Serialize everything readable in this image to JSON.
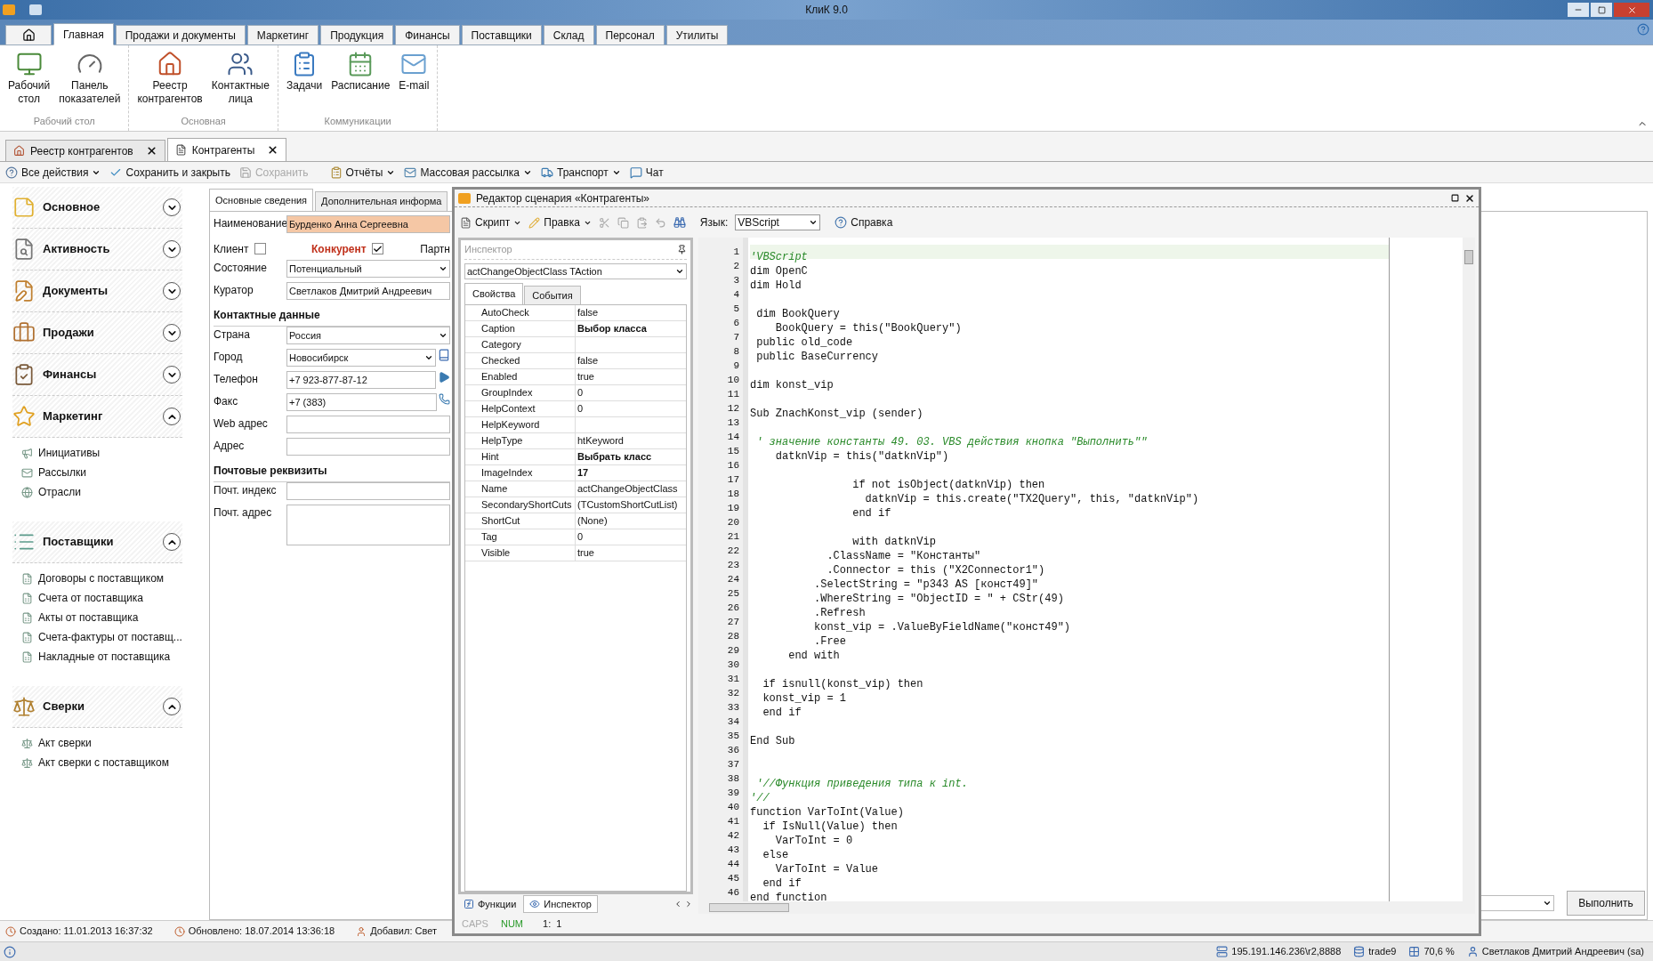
{
  "window": {
    "title": "КлиК 9.0"
  },
  "ribbon": {
    "tabs": [
      {
        "label": "Главная",
        "selected": true
      },
      {
        "label": "Продажи и документы",
        "selected": false
      },
      {
        "label": "Маркетинг",
        "selected": false
      },
      {
        "label": "Продукция",
        "selected": false
      },
      {
        "label": "Финансы",
        "selected": false
      },
      {
        "label": "Поставщики",
        "selected": false
      },
      {
        "label": "Склад",
        "selected": false
      },
      {
        "label": "Персонал",
        "selected": false
      },
      {
        "label": "Утилиты",
        "selected": false
      }
    ],
    "groups": [
      {
        "label": "Рабочий стол",
        "buttons": [
          "Рабочий\nстол",
          "Панель\nпоказателей"
        ]
      },
      {
        "label": "Основная",
        "buttons": [
          "Реестр\nконтрагентов",
          "Контактные\nлица"
        ]
      },
      {
        "label": "Коммуникации",
        "buttons": [
          "Задачи",
          "Расписание",
          "E-mail"
        ]
      }
    ]
  },
  "document_tabs": [
    {
      "label": "Реестр контрагентов",
      "selected": false
    },
    {
      "label": "Контрагенты",
      "selected": true
    }
  ],
  "toolbar": [
    {
      "label": "Все действия",
      "dropdown": true,
      "disabled": false
    },
    {
      "label": "Сохранить и закрыть",
      "dropdown": false,
      "disabled": false
    },
    {
      "label": "Сохранить",
      "dropdown": false,
      "disabled": true
    },
    {
      "label": "Отчёты",
      "dropdown": true,
      "disabled": false
    },
    {
      "label": "Массовая рассылка",
      "dropdown": true,
      "disabled": false
    },
    {
      "label": "Транспорт",
      "dropdown": true,
      "disabled": false
    },
    {
      "label": "Чат",
      "dropdown": false,
      "disabled": false
    }
  ],
  "sidebar": [
    {
      "title": "Основное",
      "expanded": false
    },
    {
      "title": "Активность",
      "expanded": false
    },
    {
      "title": "Документы",
      "expanded": false
    },
    {
      "title": "Продажи",
      "expanded": false
    },
    {
      "title": "Финансы",
      "expanded": false
    },
    {
      "title": "Маркетинг",
      "expanded": true,
      "items": [
        "Инициативы",
        "Рассылки",
        "Отрасли"
      ]
    },
    {
      "title": "Поставщики",
      "expanded": true,
      "items": [
        "Договоры с поставщиком",
        "Счета от поставщика",
        "Акты от поставщика",
        "Счета-фактуры от поставщ...",
        "Накладные от поставщика"
      ]
    },
    {
      "title": "Сверки",
      "expanded": true,
      "items": [
        "Акт сверки",
        "Акт сверки с поставщиком"
      ]
    }
  ],
  "form": {
    "tabs": [
      {
        "label": "Основные сведения",
        "selected": true
      },
      {
        "label": "Дополнительная информа",
        "selected": false
      }
    ],
    "fields": [
      {
        "kind": "text",
        "label": "Наименование",
        "value": "Бурденко Анна Сергеевна",
        "required": true
      },
      {
        "kind": "checks",
        "items": [
          {
            "label": "Клиент",
            "checked": false,
            "emphasized": false
          },
          {
            "label": "Конкурент",
            "checked": true,
            "emphasized": true
          }
        ],
        "trailing": "Партн"
      },
      {
        "kind": "select",
        "label": "Состояние",
        "value": "Потенциальный",
        "required": false
      },
      {
        "kind": "text",
        "label": "Куратор",
        "value": "Светлаков Дмитрий Андреевич",
        "required": false
      },
      {
        "kind": "heading",
        "label": "Контактные данные"
      },
      {
        "kind": "select",
        "label": "Страна",
        "value": "Россия",
        "required": false
      },
      {
        "kind": "select-book",
        "label": "Город",
        "value": "Новосибирск",
        "required": false
      },
      {
        "kind": "text-go",
        "label": "Телефон",
        "value": "+7 923-877-87-12",
        "required": false
      },
      {
        "kind": "text-phone",
        "label": "Факс",
        "value": "+7 (383)",
        "required": false
      },
      {
        "kind": "text",
        "label": "Web адрес",
        "required": false
      },
      {
        "kind": "text",
        "label": "Адрес",
        "required": false
      },
      {
        "kind": "heading",
        "label": "Почтовые реквизиты"
      },
      {
        "kind": "text",
        "label": "Почт. индекс",
        "required": false
      },
      {
        "kind": "area",
        "label": "Почт. адрес",
        "required": false
      }
    ],
    "run_button": "Выполнить"
  },
  "record_status": [
    "Создано: 11.01.2013 16:37:32",
    "Обновлено: 18.07.2014 13:36:18",
    "Добавил: Свет"
  ],
  "editor": {
    "title": "Редактор сценария «Контрагенты»",
    "menus": [
      "Скрипт",
      "Правка"
    ],
    "language_label": "Язык:",
    "language": "VBScript",
    "help": "Справка",
    "inspector": {
      "title": "Инспектор",
      "object": "actChangeObjectClass TAction",
      "tabs": [
        {
          "label": "Свойства",
          "selected": true
        },
        {
          "label": "События",
          "selected": false
        }
      ],
      "properties": [
        {
          "name": "AutoCheck",
          "value": "false",
          "modified": false
        },
        {
          "name": "Caption",
          "value": "Выбор класса",
          "modified": true
        },
        {
          "name": "Category"
        },
        {
          "name": "Checked",
          "value": "false",
          "modified": false
        },
        {
          "name": "Enabled",
          "value": "true",
          "modified": false
        },
        {
          "name": "GroupIndex",
          "value": "0",
          "modified": false
        },
        {
          "name": "HelpContext",
          "value": "0",
          "modified": false
        },
        {
          "name": "HelpKeyword"
        },
        {
          "name": "HelpType",
          "value": "htKeyword",
          "modified": false
        },
        {
          "name": "Hint",
          "value": "Выбрать класс",
          "modified": true
        },
        {
          "name": "ImageIndex",
          "value": "17",
          "modified": true
        },
        {
          "name": "Name",
          "value": "actChangeObjectClass",
          "modified": false
        },
        {
          "name": "SecondaryShortCuts",
          "value": "(TCustomShortCutList)",
          "modified": false
        },
        {
          "name": "ShortCut",
          "value": "(None)",
          "modified": false
        },
        {
          "name": "Tag",
          "value": "0",
          "modified": false
        },
        {
          "name": "Visible",
          "value": "true",
          "modified": false
        }
      ]
    },
    "bottom_tabs": [
      {
        "label": "Функции",
        "selected": false
      },
      {
        "label": "Инспектор",
        "selected": true
      }
    ],
    "code": [
      {
        "number": "1",
        "text": "'VBScript",
        "kind": "comment"
      },
      {
        "number": "2",
        "text": "dim OpenC",
        "kind": "code"
      },
      {
        "number": "3",
        "text": "dim Hold",
        "kind": "code"
      },
      {
        "number": "4"
      },
      {
        "number": "5",
        "text": " dim BookQuery",
        "kind": "code"
      },
      {
        "number": "6",
        "text": "    BookQuery = this(\"BookQuery\")",
        "kind": "code"
      },
      {
        "number": "7",
        "text": " public old_code",
        "kind": "code"
      },
      {
        "number": "8",
        "text": " public BaseCurrency",
        "kind": "code"
      },
      {
        "number": "9"
      },
      {
        "number": "10",
        "text": "dim konst_vip",
        "kind": "code"
      },
      {
        "number": "11"
      },
      {
        "number": "12",
        "text": "Sub ZnachKonst_vip (sender)",
        "kind": "code"
      },
      {
        "number": "13"
      },
      {
        "number": "14",
        "text": " ' значение константы 49. 03. VBS действия кнопка \"Выполнить\"\"",
        "kind": "comment"
      },
      {
        "number": "15",
        "text": "    datknVip = this(\"datknVip\")",
        "kind": "code"
      },
      {
        "number": "16"
      },
      {
        "number": "17",
        "text": "                if not isObject(datknVip) then",
        "kind": "code"
      },
      {
        "number": "18",
        "text": "                  datknVip = this.create(\"TX2Query\", this, \"datknVip\")",
        "kind": "code"
      },
      {
        "number": "19",
        "text": "                end if",
        "kind": "code"
      },
      {
        "number": "20"
      },
      {
        "number": "21",
        "text": "                with datknVip",
        "kind": "code"
      },
      {
        "number": "22",
        "text": "            .ClassName = \"Константы\"",
        "kind": "code"
      },
      {
        "number": "23",
        "text": "            .Connector = this (\"X2Connector1\")",
        "kind": "code"
      },
      {
        "number": "24",
        "text": "          .SelectString = \"p343 AS [конст49]\"",
        "kind": "code"
      },
      {
        "number": "25",
        "text": "          .WhereString = \"ObjectID = \" + CStr(49)",
        "kind": "code"
      },
      {
        "number": "26",
        "text": "          .Refresh",
        "kind": "code"
      },
      {
        "number": "27",
        "text": "          konst_vip = .ValueByFieldName(\"конст49\")",
        "kind": "code"
      },
      {
        "number": "28",
        "text": "          .Free",
        "kind": "code"
      },
      {
        "number": "29",
        "text": "      end with",
        "kind": "code"
      },
      {
        "number": "30"
      },
      {
        "number": "31",
        "text": "  if isnull(konst_vip) then",
        "kind": "code"
      },
      {
        "number": "32",
        "text": "  konst_vip = 1",
        "kind": "code"
      },
      {
        "number": "33",
        "text": "  end if",
        "kind": "code"
      },
      {
        "number": "34"
      },
      {
        "number": "35",
        "text": "End Sub",
        "kind": "code"
      },
      {
        "number": "36"
      },
      {
        "number": "37"
      },
      {
        "number": "38",
        "text": " '//Функция приведения типа к int.",
        "kind": "comment"
      },
      {
        "number": "39",
        "text": "'//",
        "kind": "comment"
      },
      {
        "number": "40",
        "text": "function VarToInt(Value)",
        "kind": "code"
      },
      {
        "number": "41",
        "text": "  if IsNull(Value) then",
        "kind": "code"
      },
      {
        "number": "42",
        "text": "    VarToInt = 0",
        "kind": "code"
      },
      {
        "number": "43",
        "text": "  else",
        "kind": "code"
      },
      {
        "number": "44",
        "text": "    VarToInt = Value",
        "kind": "code"
      },
      {
        "number": "45",
        "text": "  end if",
        "kind": "code"
      },
      {
        "number": "46",
        "text": "end function",
        "kind": "code"
      }
    ],
    "status": {
      "caps": "CAPS",
      "num": "NUM",
      "position": "1:  1"
    }
  },
  "status_bar": {
    "server": "195.191.146.236\\r2,8888",
    "database": "trade9",
    "load": "70,6 %",
    "user": "Светлаков Дмитрий Андреевич (sa)"
  }
}
